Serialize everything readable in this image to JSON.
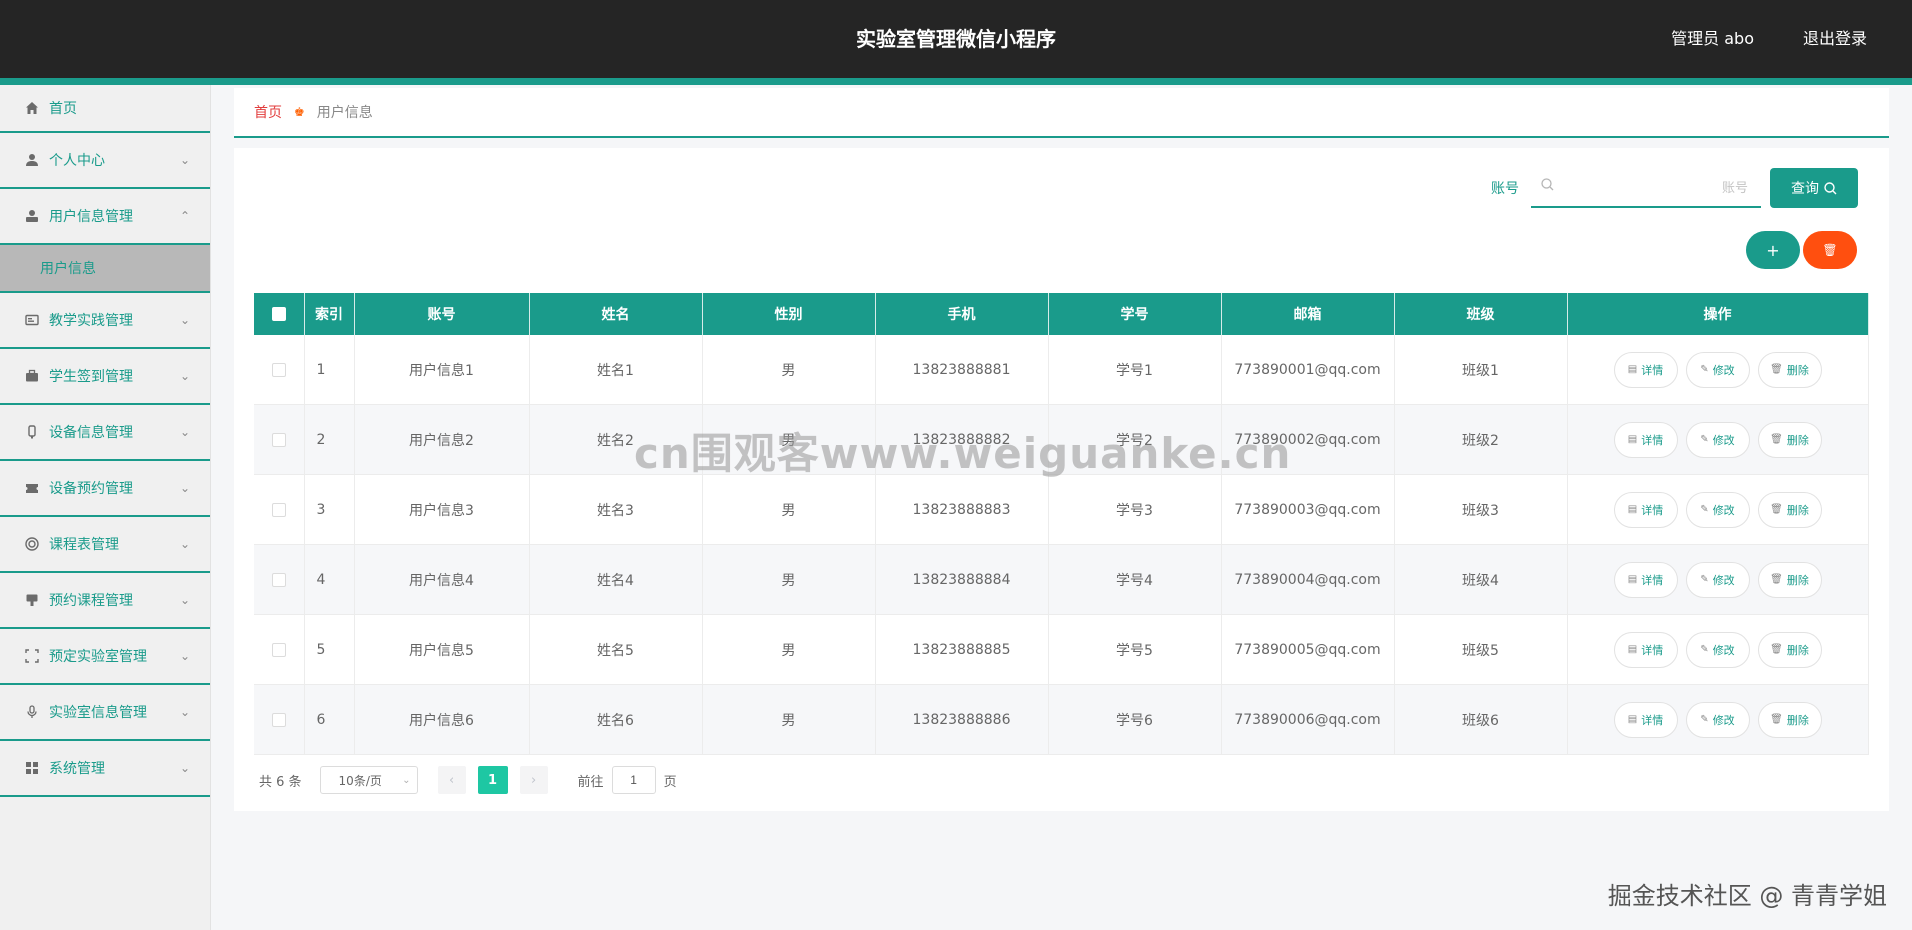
{
  "header": {
    "title": "实验室管理微信小程序",
    "user_label": "管理员 abo",
    "logout_label": "退出登录"
  },
  "sidebar": {
    "items": [
      {
        "label": "首页",
        "icon": "home-icon",
        "has_chevron": false
      },
      {
        "label": "个人中心",
        "icon": "user-icon",
        "has_chevron": true
      },
      {
        "label": "用户信息管理",
        "icon": "user-manage-icon",
        "has_chevron": true,
        "expanded": true
      },
      {
        "label": "教学实践管理",
        "icon": "card-icon",
        "has_chevron": true
      },
      {
        "label": "学生签到管理",
        "icon": "briefcase-icon",
        "has_chevron": true
      },
      {
        "label": "设备信息管理",
        "icon": "device-icon",
        "has_chevron": true
      },
      {
        "label": "设备预约管理",
        "icon": "ticket-icon",
        "has_chevron": true
      },
      {
        "label": "课程表管理",
        "icon": "circle-icon",
        "has_chevron": true
      },
      {
        "label": "预约课程管理",
        "icon": "stamp-icon",
        "has_chevron": true
      },
      {
        "label": "预定实验室管理",
        "icon": "frame-icon",
        "has_chevron": true
      },
      {
        "label": "实验室信息管理",
        "icon": "mic-icon",
        "has_chevron": true
      },
      {
        "label": "系统管理",
        "icon": "grid-icon",
        "has_chevron": true
      }
    ],
    "submenu": {
      "label": "用户信息"
    }
  },
  "breadcrumb": {
    "home": "首页",
    "current": "用户信息"
  },
  "search": {
    "label": "账号",
    "placeholder": "账号",
    "value": "",
    "button_label": "查询"
  },
  "actions": {
    "add_label": "+",
    "delete_label": "🗑"
  },
  "table": {
    "columns": [
      "",
      "索引",
      "账号",
      "姓名",
      "性别",
      "手机",
      "学号",
      "邮箱",
      "班级",
      "操作"
    ],
    "rows": [
      {
        "index": "1",
        "account": "用户信息1",
        "name": "姓名1",
        "gender": "男",
        "phone": "13823888881",
        "student_id": "学号1",
        "email": "773890001@qq.com",
        "class": "班级1"
      },
      {
        "index": "2",
        "account": "用户信息2",
        "name": "姓名2",
        "gender": "男",
        "phone": "13823888882",
        "student_id": "学号2",
        "email": "773890002@qq.com",
        "class": "班级2"
      },
      {
        "index": "3",
        "account": "用户信息3",
        "name": "姓名3",
        "gender": "男",
        "phone": "13823888883",
        "student_id": "学号3",
        "email": "773890003@qq.com",
        "class": "班级3"
      },
      {
        "index": "4",
        "account": "用户信息4",
        "name": "姓名4",
        "gender": "男",
        "phone": "13823888884",
        "student_id": "学号4",
        "email": "773890004@qq.com",
        "class": "班级4"
      },
      {
        "index": "5",
        "account": "用户信息5",
        "name": "姓名5",
        "gender": "男",
        "phone": "13823888885",
        "student_id": "学号5",
        "email": "773890005@qq.com",
        "class": "班级5"
      },
      {
        "index": "6",
        "account": "用户信息6",
        "name": "姓名6",
        "gender": "男",
        "phone": "13823888886",
        "student_id": "学号6",
        "email": "773890006@qq.com",
        "class": "班级6"
      }
    ],
    "row_actions": {
      "detail": "详情",
      "edit": "修改",
      "delete": "删除"
    }
  },
  "pagination": {
    "total": "共 6 条",
    "page_size": "10条/页",
    "current_page": "1",
    "goto_prefix": "前往",
    "goto_value": "1",
    "goto_suffix": "页"
  },
  "watermark": {
    "text": "cn围观客www.weiguanke.cn"
  },
  "footer_watermark": {
    "text": "掘金技术社区 @ 青青学姐"
  },
  "colors": {
    "accent": "#1a9b8b",
    "danger": "#ff4f0f",
    "header_bg": "#252525",
    "page_active": "#1ec7a3"
  }
}
